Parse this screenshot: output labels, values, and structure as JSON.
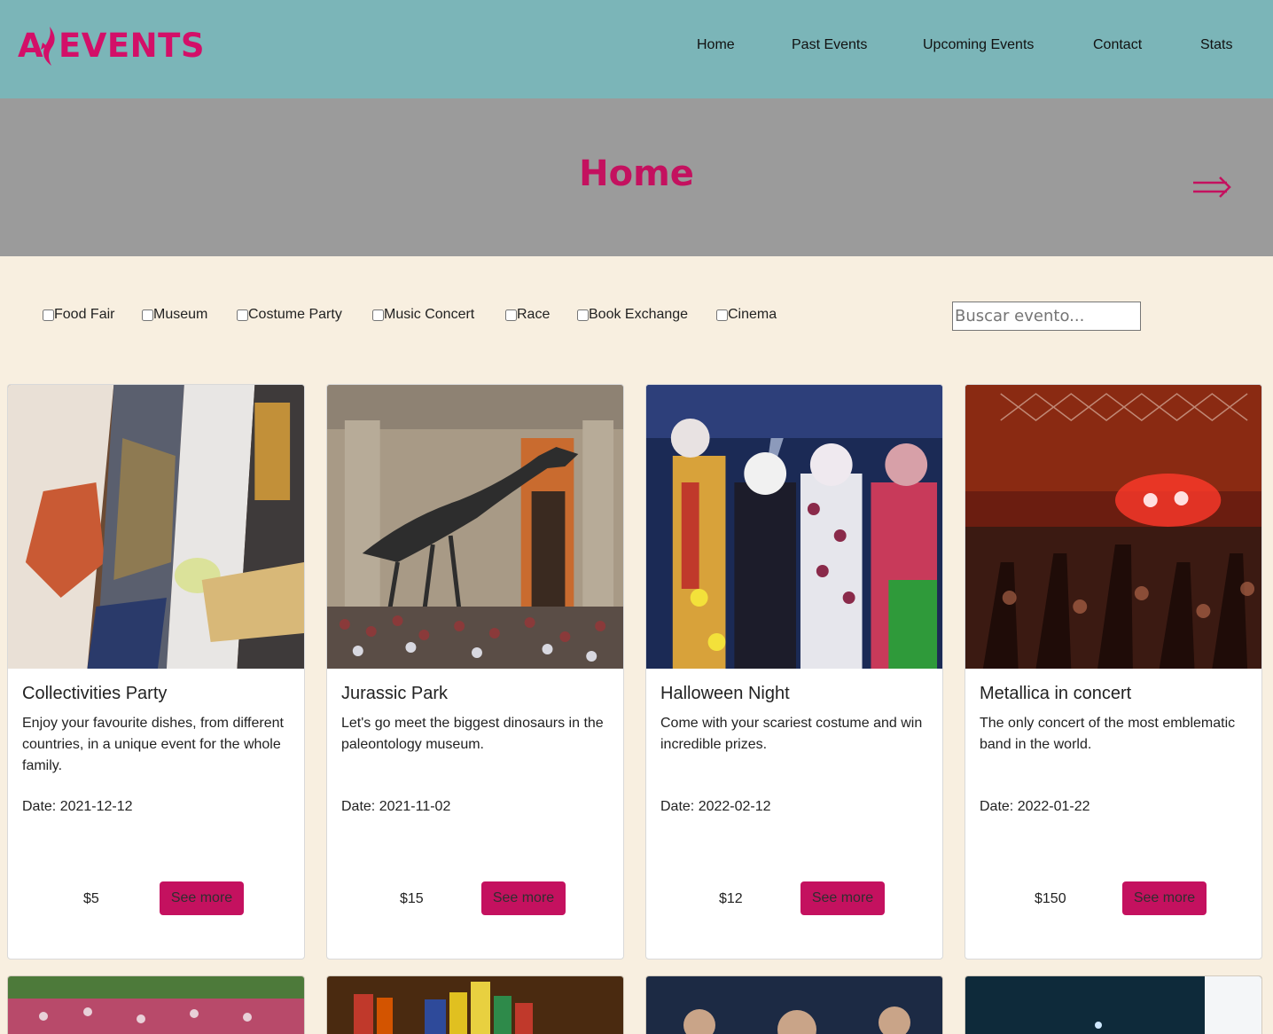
{
  "brand": {
    "logo_a": "A",
    "logo_events": "EVENTS",
    "color": "#d30f68"
  },
  "nav": {
    "items": [
      {
        "label": "Home"
      },
      {
        "label": "Past Events"
      },
      {
        "label": "Upcoming Events"
      },
      {
        "label": "Contact"
      },
      {
        "label": "Stats"
      }
    ]
  },
  "hero": {
    "title": "Home",
    "arrow_icon": "right-arrow-icon"
  },
  "filters": {
    "categories": [
      {
        "label": "Food Fair",
        "checked": false
      },
      {
        "label": "Museum",
        "checked": false
      },
      {
        "label": "Costume Party",
        "checked": false
      },
      {
        "label": "Music Concert",
        "checked": false
      },
      {
        "label": "Race",
        "checked": false
      },
      {
        "label": "Book Exchange",
        "checked": false
      },
      {
        "label": "Cinema",
        "checked": false
      }
    ],
    "search_placeholder": "Buscar evento..."
  },
  "events": [
    {
      "title": "Collectivities Party",
      "description": "Enjoy your favourite dishes, from different countries, in a unique event for the whole family.",
      "date": "Date: 2021-12-12",
      "price": "$5",
      "button": "See more"
    },
    {
      "title": "Jurassic Park",
      "description": "Let's go meet the biggest dinosaurs in the paleontology museum.",
      "date": "Date: 2021-11-02",
      "price": "$15",
      "button": "See more"
    },
    {
      "title": "Halloween Night",
      "description": "Come with your scariest costume and win incredible prizes.",
      "date": "Date: 2022-02-12",
      "price": "$12",
      "button": "See more"
    },
    {
      "title": "Metallica in concert",
      "description": "The only concert of the most emblematic band in the world.",
      "date": "Date: 2022-01-22",
      "price": "$150",
      "button": "See more"
    }
  ],
  "colors": {
    "header_bg": "#7bb5b8",
    "hero_bg": "#9b9b9b",
    "page_bg": "#f8efe0",
    "accent": "#c4115f"
  }
}
